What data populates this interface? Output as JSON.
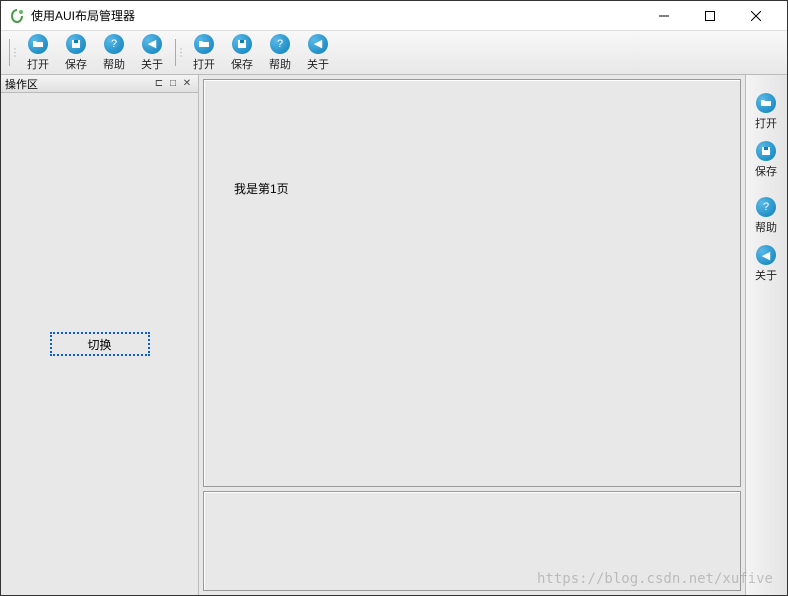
{
  "window": {
    "title": "使用AUI布局管理器"
  },
  "toolbar": {
    "group1": [
      {
        "label": "打开",
        "icon": "📂",
        "name": "open"
      },
      {
        "label": "保存",
        "icon": "💾",
        "name": "save"
      },
      {
        "label": "帮助",
        "icon": "?",
        "name": "help"
      },
      {
        "label": "关于",
        "icon": "◀",
        "name": "about"
      }
    ],
    "group2": [
      {
        "label": "打开",
        "icon": "📂",
        "name": "open"
      },
      {
        "label": "保存",
        "icon": "💾",
        "name": "save"
      },
      {
        "label": "帮助",
        "icon": "?",
        "name": "help"
      },
      {
        "label": "关于",
        "icon": "◀",
        "name": "about"
      }
    ]
  },
  "rightToolbar": [
    {
      "label": "打开",
      "icon": "📂",
      "name": "open"
    },
    {
      "label": "保存",
      "icon": "💾",
      "name": "save"
    },
    {
      "label": "帮助",
      "icon": "?",
      "name": "help"
    },
    {
      "label": "关于",
      "icon": "◀",
      "name": "about"
    }
  ],
  "leftPane": {
    "title": "操作区",
    "switchLabel": "切换"
  },
  "content": {
    "page1Text": "我是第1页"
  },
  "watermark": "https://blog.csdn.net/xufive"
}
